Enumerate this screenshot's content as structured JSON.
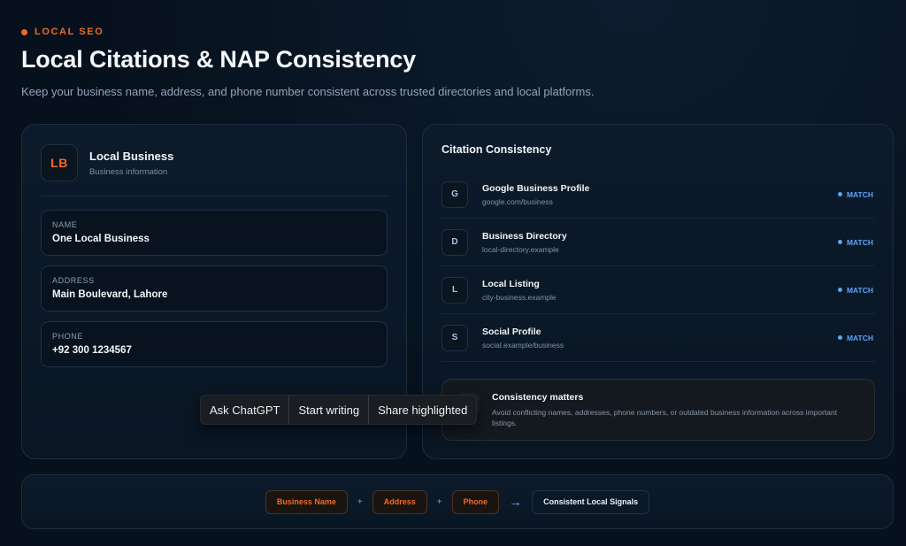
{
  "header": {
    "eyebrow": "LOCAL SEO",
    "title": "Local Citations & NAP Consistency",
    "subtitle": "Keep your business name, address, and phone number consistent across trusted directories and local platforms."
  },
  "business": {
    "logo_text": "LB",
    "name": "Local Business",
    "sub": "Business information",
    "fields": [
      {
        "label": "NAME",
        "value": "One Local Business"
      },
      {
        "label": "ADDRESS",
        "value": "Main Boulevard, Lahore"
      },
      {
        "label": "PHONE",
        "value": "+92 300 1234567"
      }
    ]
  },
  "citations": {
    "title": "Citation Consistency",
    "items": [
      {
        "letter": "G",
        "name": "Google Business Profile",
        "url": "google.com/business",
        "status": "MATCH"
      },
      {
        "letter": "D",
        "name": "Business Directory",
        "url": "local-directory.example",
        "status": "MATCH"
      },
      {
        "letter": "L",
        "name": "Local Listing",
        "url": "city-business.example",
        "status": "MATCH"
      },
      {
        "letter": "S",
        "name": "Social Profile",
        "url": "social.example/business",
        "status": "MATCH"
      }
    ],
    "note": {
      "title": "Consistency matters",
      "desc": "Avoid conflicting names, addresses, phone numbers, or outdated business information across important listings."
    }
  },
  "popup": {
    "ask": "Ask ChatGPT",
    "write": "Start writing",
    "share": "Share highlighted"
  },
  "flow": {
    "chips": [
      "Business Name",
      "Address",
      "Phone"
    ],
    "plus": "+",
    "arrow": "→",
    "result": "Consistent Local Signals"
  },
  "colors": {
    "accent_orange": "#ef6a22",
    "accent_blue": "#5ea4f4",
    "background": "#07111d"
  }
}
